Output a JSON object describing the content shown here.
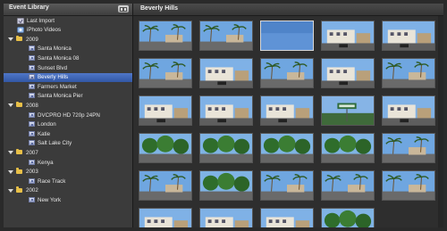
{
  "sidebar": {
    "title": "Event Library",
    "items": [
      {
        "label": "Last Import",
        "kind": "special",
        "indent": 0
      },
      {
        "label": "iPhoto Videos",
        "kind": "special",
        "indent": 0
      },
      {
        "label": "2009",
        "kind": "year",
        "indent": 0
      },
      {
        "label": "Santa Monica",
        "kind": "event",
        "indent": 1
      },
      {
        "label": "Santa Monica 08",
        "kind": "event",
        "indent": 1
      },
      {
        "label": "Sunset Blvd",
        "kind": "event",
        "indent": 1
      },
      {
        "label": "Beverly Hills",
        "kind": "event",
        "indent": 1,
        "selected": true
      },
      {
        "label": "Farmers Market",
        "kind": "event",
        "indent": 1
      },
      {
        "label": "Santa Monica Pier",
        "kind": "event",
        "indent": 1
      },
      {
        "label": "2008",
        "kind": "year",
        "indent": 0
      },
      {
        "label": "DVCPRO HD 720p 24PN",
        "kind": "event",
        "indent": 1
      },
      {
        "label": "London",
        "kind": "event",
        "indent": 1
      },
      {
        "label": "Katie",
        "kind": "event",
        "indent": 1
      },
      {
        "label": "Salt Lake City",
        "kind": "event",
        "indent": 1
      },
      {
        "label": "2007",
        "kind": "year",
        "indent": 0
      },
      {
        "label": "Kenya",
        "kind": "event",
        "indent": 1
      },
      {
        "label": "2003",
        "kind": "year",
        "indent": 0
      },
      {
        "label": "Race Track",
        "kind": "event",
        "indent": 1
      },
      {
        "label": "2002",
        "kind": "year",
        "indent": 0
      },
      {
        "label": "New York",
        "kind": "event",
        "indent": 1
      }
    ]
  },
  "main": {
    "title": "Beverly Hills",
    "thumbnails": [
      "palm-street",
      "palm-street",
      "clear-sky",
      "building-street",
      "building-street",
      "palm-street",
      "building-street",
      "palm-street",
      "building-street",
      "palm-street",
      "building-street",
      "building-street",
      "building-street",
      "street-sign",
      "building-street",
      "trees",
      "trees",
      "trees",
      "trees",
      "palm-street",
      "palm-street",
      "trees",
      "palm-street",
      "palm-street",
      "palm-street",
      "building-street",
      "building-street",
      "building-street",
      "trees"
    ],
    "selected_index": 2
  },
  "colors": {
    "selection": "#3a62b5",
    "folder": "#e8c048"
  }
}
